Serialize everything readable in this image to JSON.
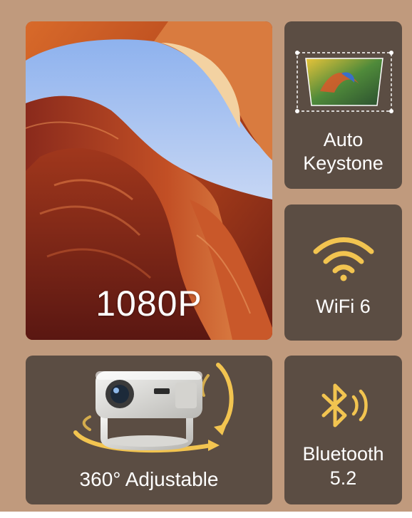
{
  "colors": {
    "background": "#c09a7d",
    "tile": "#5b4d43",
    "accent_gold": "#f2c450",
    "text": "#ffffff"
  },
  "hero": {
    "label": "1080P",
    "image": "canyon-rock-photo"
  },
  "features": [
    {
      "icon": "auto-keystone-icon",
      "label_line1": "Auto",
      "label_line2": "Keystone"
    },
    {
      "icon": "wifi-icon",
      "label_line1": "WiFi 6"
    },
    {
      "icon": "projector-rotate-icon",
      "label_line1": "360° Adjustable"
    },
    {
      "icon": "bluetooth-icon",
      "label_line1": "Bluetooth",
      "label_line2": "5.2"
    }
  ]
}
